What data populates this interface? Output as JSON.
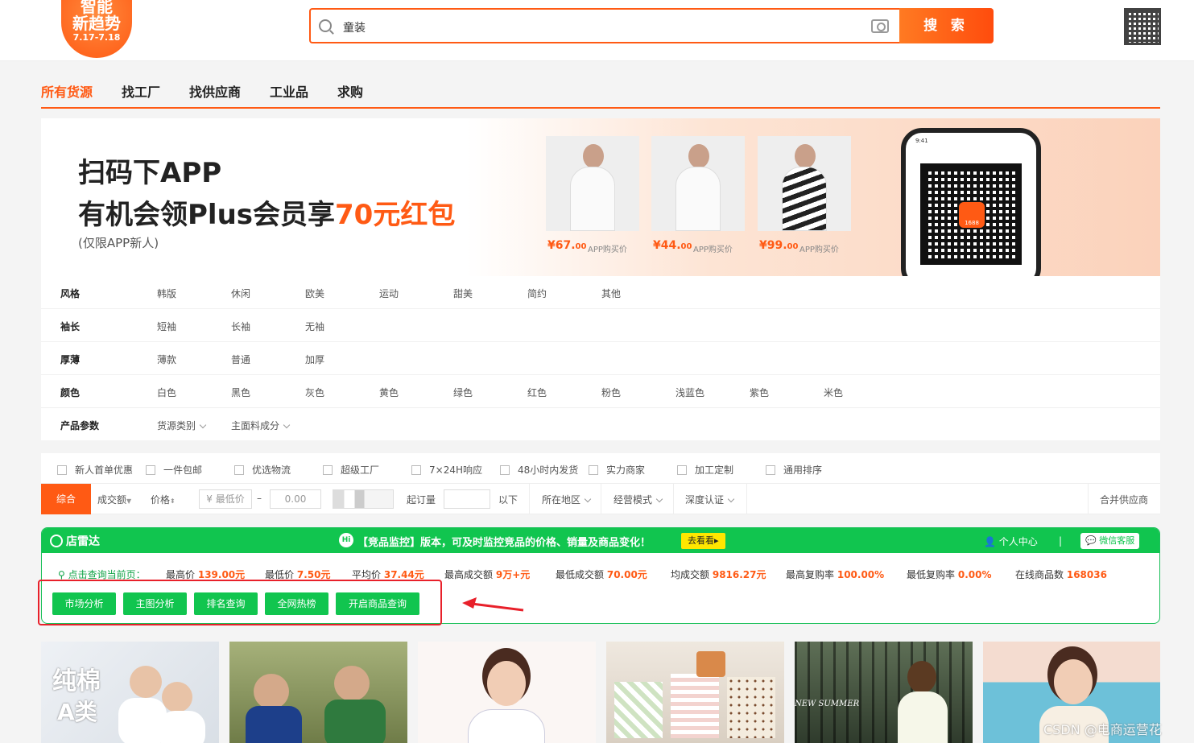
{
  "header": {
    "logo_line1": "智能",
    "logo_line2": "新趋势",
    "logo_date": "7.17-7.18",
    "search_value": "童装",
    "search_button": "搜 索"
  },
  "nav": {
    "tabs": [
      "所有货源",
      "找工厂",
      "找供应商",
      "工业品",
      "求购"
    ]
  },
  "banner": {
    "line1": "扫码下APP",
    "line2_prefix": "有机会领Plus会员享",
    "line2_highlight": "70元红包",
    "line3": "(仅限APP新人)",
    "products": [
      {
        "price_int": "¥67.",
        "price_dec": "00",
        "tag": "APP购买价"
      },
      {
        "price_int": "¥44.",
        "price_dec": "00",
        "tag": "APP购买价"
      },
      {
        "price_int": "¥99.",
        "price_dec": "00",
        "tag": "APP购买价"
      }
    ],
    "phone_time": "9:41",
    "qr_logo": "1688"
  },
  "filters": {
    "rows": [
      {
        "label": "风格",
        "options": [
          "韩版",
          "休闲",
          "欧美",
          "运动",
          "甜美",
          "简约",
          "其他"
        ]
      },
      {
        "label": "袖长",
        "options": [
          "短袖",
          "长袖",
          "无袖"
        ]
      },
      {
        "label": "厚薄",
        "options": [
          "薄款",
          "普通",
          "加厚"
        ]
      },
      {
        "label": "颜色",
        "options": [
          "白色",
          "黑色",
          "灰色",
          "黄色",
          "绿色",
          "红色",
          "粉色",
          "浅蓝色",
          "紫色",
          "米色"
        ]
      },
      {
        "label": "产品参数",
        "options": [
          "货源类别",
          "主面料成分"
        ]
      }
    ]
  },
  "services": [
    "新人首单优惠",
    "一件包邮",
    "优选物流",
    "超级工厂",
    "7×24H响应",
    "48小时内发货",
    "实力商家",
    "加工定制",
    "通用排序"
  ],
  "sort": {
    "active": "综合",
    "volume": "成交额",
    "price": "价格",
    "min_price": "¥ 最低价",
    "dash": "–",
    "max_price": "0.00",
    "moq": "起订量",
    "below": "以下",
    "region": "所在地区",
    "mode": "经营模式",
    "cert": "深度认证",
    "merge": "合并供应商"
  },
  "plugin": {
    "brand": "店雷达",
    "hi": "Hi",
    "notice": "【竞品监控】版本，可及时监控竞品的价格、销量及商品变化！",
    "go": "去看看▸",
    "user_center": "个人中心",
    "sep": "|",
    "wechat": "微信客服",
    "query_label": "点击查询当前页：",
    "stats": [
      {
        "label": "最高价",
        "value": "139.00元"
      },
      {
        "label": "最低价",
        "value": "7.50元"
      },
      {
        "label": "平均价",
        "value": "37.44元"
      },
      {
        "label": "最高成交额",
        "value": "9万+元"
      },
      {
        "label": "最低成交额",
        "value": "70.00元"
      },
      {
        "label": "均成交额",
        "value": "9816.27元"
      },
      {
        "label": "最高复购率",
        "value": "100.00%"
      },
      {
        "label": "最低复购率",
        "value": "0.00%"
      },
      {
        "label": "在线商品数",
        "value": "168036"
      }
    ],
    "buttons": [
      "市场分析",
      "主图分析",
      "排名查询",
      "全网热榜",
      "开启商品查询"
    ]
  },
  "product_images": {
    "first_overlay_line1": "纯棉",
    "first_overlay_line2": "A类",
    "summer_text": "NEW SUMMER"
  },
  "watermark": "CSDN @电商运营花",
  "colors": {
    "accent": "#ff5a14",
    "green": "#11c54f",
    "red_box": "#e8202a"
  }
}
